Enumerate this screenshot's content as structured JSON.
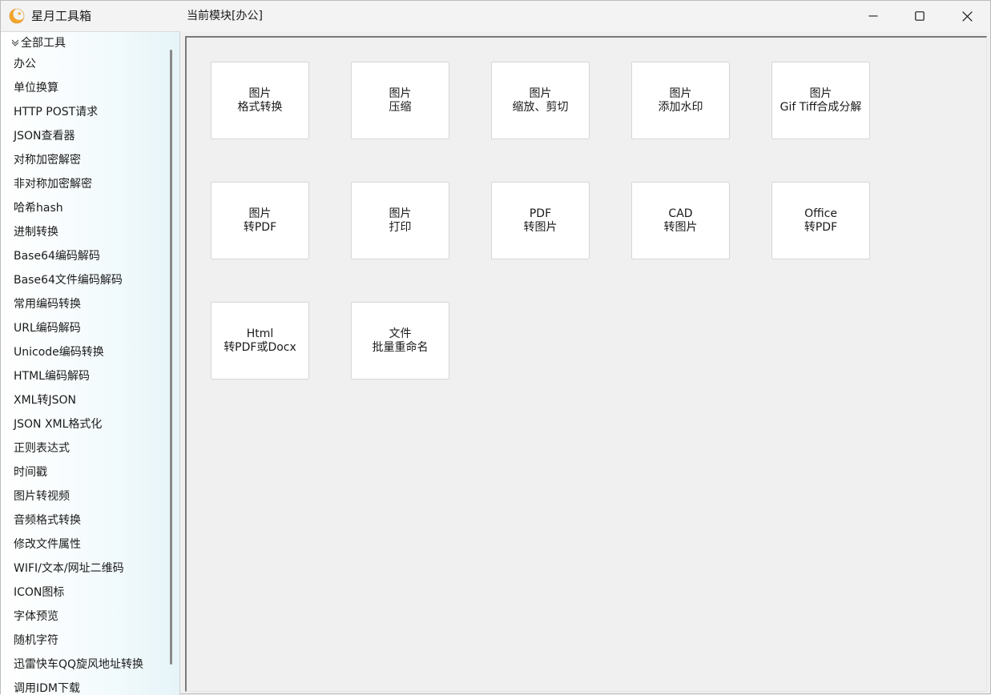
{
  "window": {
    "app_title": "星月工具箱",
    "module_title": "当前模块[办公]",
    "controls": {
      "minimize": "minimize-icon",
      "maximize": "maximize-icon",
      "close": "close-icon"
    }
  },
  "sidebar": {
    "root_label": "全部工具",
    "items": [
      "办公",
      "单位换算",
      "HTTP POST请求",
      "JSON查看器",
      "对称加密解密",
      "非对称加密解密",
      "哈希hash",
      "进制转换",
      "Base64编码解码",
      "Base64文件编码解码",
      "常用编码转换",
      "URL编码解码",
      "Unicode编码转换",
      "HTML编码解码",
      "XML转JSON",
      "JSON XML格式化",
      "正则表达式",
      "时间戳",
      "图片转视频",
      "音频格式转换",
      "修改文件属性",
      "WIFI/文本/网址二维码",
      "ICON图标",
      "字体预览",
      "随机字符",
      "迅雷快车QQ旋风地址转换",
      "调用IDM下载"
    ]
  },
  "tools": [
    {
      "line1": "图片",
      "line2": "格式转换"
    },
    {
      "line1": "图片",
      "line2": "压缩"
    },
    {
      "line1": "图片",
      "line2": "缩放、剪切"
    },
    {
      "line1": "图片",
      "line2": "添加水印"
    },
    {
      "line1": "图片",
      "line2": "Gif Tiff合成分解"
    },
    {
      "line1": "图片",
      "line2": "转PDF"
    },
    {
      "line1": "图片",
      "line2": "打印"
    },
    {
      "line1": "PDF",
      "line2": "转图片"
    },
    {
      "line1": "CAD",
      "line2": "转图片"
    },
    {
      "line1": "Office",
      "line2": "转PDF"
    },
    {
      "line1": "Html",
      "line2": "转PDF或Docx"
    },
    {
      "line1": "文件",
      "line2": "批量重命名"
    }
  ],
  "colors": {
    "logo": "#f0a030",
    "accent_border": "#7a7a7a"
  }
}
